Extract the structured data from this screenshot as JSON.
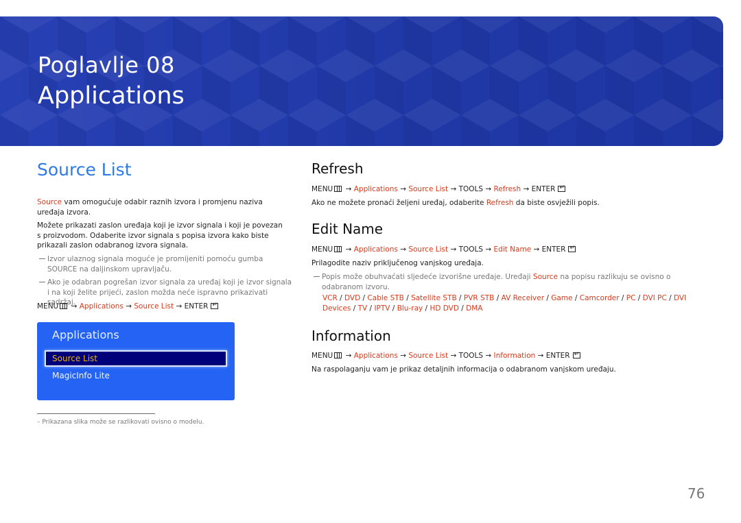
{
  "header": {
    "chapter": "Poglavlje  08",
    "title": "Applications",
    "color": "#2038a6"
  },
  "source_list": {
    "title": "Source List",
    "p1": [
      {
        "t": "Source",
        "hl": true
      },
      {
        "t": " vam omogućuje odabir raznih izvora i promjenu naziva uređaja izvora."
      }
    ],
    "p2": [
      {
        "t": "Možete prikazati zaslon uređaja koji je izvor signala i koji je povezan s proizvodom. Odaberite izvor signala s popisa izvora kako biste prikazali zaslon odabranog izvora signala."
      }
    ],
    "note1": [
      {
        "t": "Izvor ulaznog signala moguće je promijeniti pomoću gumba SOURCE na daljinskom upravljaču."
      }
    ],
    "note2": [
      {
        "t": "Ako je odabran pogrešan izvor signala za uređaj koji je izvor signala i na koji želite prijeći, zaslon možda neće ispravno prikazivati sadržaj."
      }
    ],
    "path": [
      {
        "t": "MENU"
      },
      {
        "icon": "menu"
      },
      {
        "t": " → "
      },
      {
        "t": "Applications",
        "hl": true
      },
      {
        "t": " → "
      },
      {
        "t": "Source List",
        "hl": true
      },
      {
        "t": " → ENTER"
      },
      {
        "icon": "enter"
      }
    ]
  },
  "menu_panel": {
    "title": "Applications",
    "items": [
      "Source List",
      "MagicInfo Lite"
    ],
    "selected": "Source List",
    "bg": "#2463f3",
    "sel_text": "#f0b400"
  },
  "refresh": {
    "title": "Refresh",
    "path": [
      {
        "t": "MENU"
      },
      {
        "icon": "menu"
      },
      {
        "t": " → "
      },
      {
        "t": "Applications",
        "hl": true
      },
      {
        "t": " → "
      },
      {
        "t": "Source List",
        "hl": true
      },
      {
        "t": " → TOOLS → "
      },
      {
        "t": "Refresh",
        "hl": true
      },
      {
        "t": " → ENTER"
      },
      {
        "icon": "enter"
      }
    ],
    "p1": [
      {
        "t": "Ako ne možete pronaći željeni uređaj, odaberite "
      },
      {
        "t": "Refresh",
        "hl": true
      },
      {
        "t": " da biste osvježili popis."
      }
    ]
  },
  "edit_name": {
    "title": "Edit Name",
    "path": [
      {
        "t": "MENU"
      },
      {
        "icon": "menu"
      },
      {
        "t": " → "
      },
      {
        "t": "Applications",
        "hl": true
      },
      {
        "t": " → "
      },
      {
        "t": "Source List",
        "hl": true
      },
      {
        "t": " → TOOLS → "
      },
      {
        "t": "Edit Name",
        "hl": true
      },
      {
        "t": " → ENTER"
      },
      {
        "icon": "enter"
      }
    ],
    "p1": [
      {
        "t": "Prilagodite naziv priključenog vanjskog uređaja."
      }
    ],
    "note1": [
      {
        "t": "Popis može obuhvaćati sljedeće izvorišne uređaje. Uređaji "
      },
      {
        "t": "Source",
        "hl": true
      },
      {
        "t": " na popisu razlikuju se ovisno o odabranom izvoru."
      }
    ],
    "devices": [
      {
        "t": "VCR",
        "hl": true
      },
      {
        "t": " / "
      },
      {
        "t": "DVD",
        "hl": true
      },
      {
        "t": " / "
      },
      {
        "t": "Cable STB",
        "hl": true
      },
      {
        "t": " / "
      },
      {
        "t": "Satellite STB",
        "hl": true
      },
      {
        "t": " / "
      },
      {
        "t": "PVR STB",
        "hl": true
      },
      {
        "t": " / "
      },
      {
        "t": "AV Receiver",
        "hl": true
      },
      {
        "t": " / "
      },
      {
        "t": "Game",
        "hl": true
      },
      {
        "t": " / "
      },
      {
        "t": "Camcorder",
        "hl": true
      },
      {
        "t": " / "
      },
      {
        "t": "PC",
        "hl": true
      },
      {
        "t": " / "
      },
      {
        "t": "DVI PC",
        "hl": true
      },
      {
        "t": " / "
      },
      {
        "t": "DVI Devices",
        "hl": true
      },
      {
        "t": " / "
      },
      {
        "t": "TV",
        "hl": true
      },
      {
        "t": " / "
      },
      {
        "t": "IPTV",
        "hl": true
      },
      {
        "t": " / "
      },
      {
        "t": "Blu-ray",
        "hl": true
      },
      {
        "t": " / "
      },
      {
        "t": "HD DVD",
        "hl": true
      },
      {
        "t": " / "
      },
      {
        "t": "DMA",
        "hl": true
      }
    ]
  },
  "information": {
    "title": "Information",
    "path": [
      {
        "t": "MENU"
      },
      {
        "icon": "menu"
      },
      {
        "t": " → "
      },
      {
        "t": "Applications",
        "hl": true
      },
      {
        "t": " → "
      },
      {
        "t": "Source List",
        "hl": true
      },
      {
        "t": " → TOOLS → "
      },
      {
        "t": "Information",
        "hl": true
      },
      {
        "t": " → ENTER"
      },
      {
        "icon": "enter"
      }
    ],
    "p1": [
      {
        "t": "Na raspolaganju vam je prikaz detaljnih informacija o odabranom vanjskom uređaju."
      }
    ]
  },
  "footnote": "–  Prikazana slika može se razlikovati ovisno o modelu.",
  "page_number": "76",
  "colors": {
    "highlight": "#d63a1c",
    "heading_blue": "#2d7ae6"
  }
}
